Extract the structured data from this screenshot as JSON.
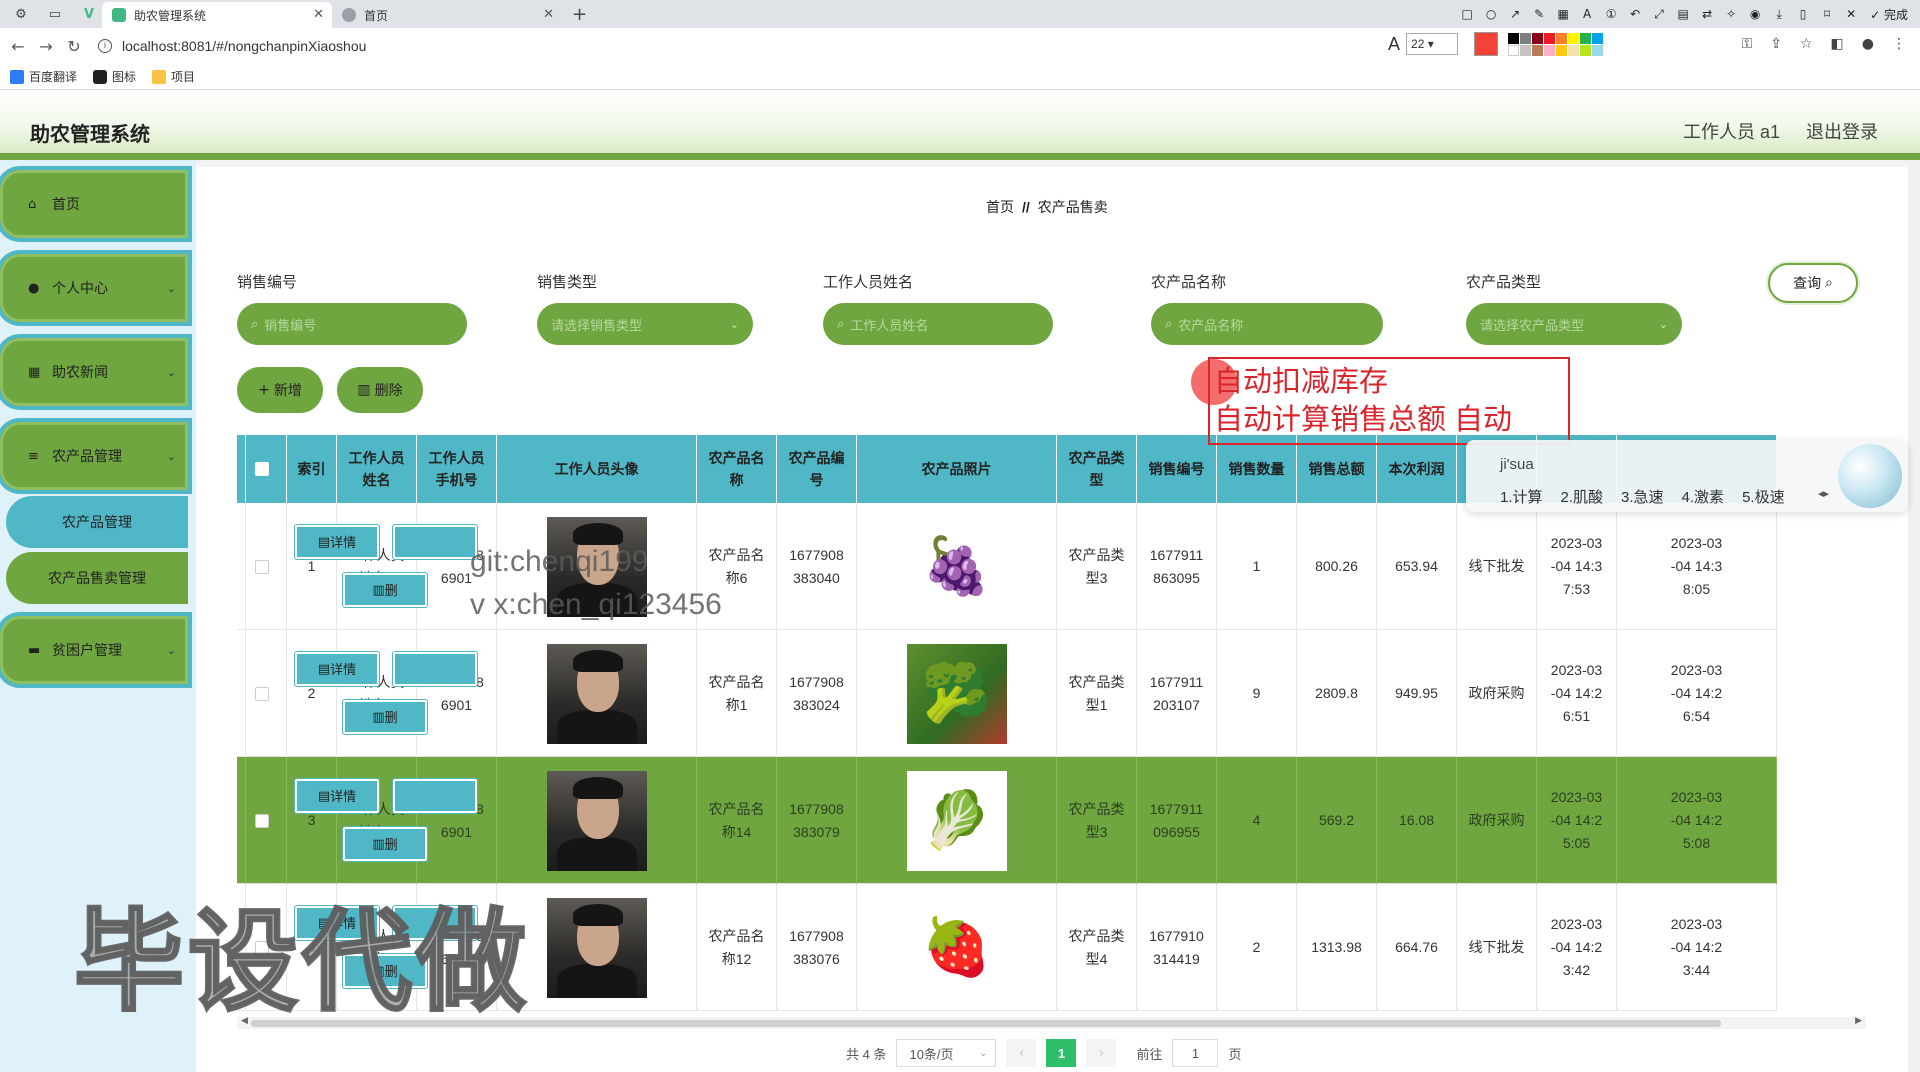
{
  "browser": {
    "tabs": [
      {
        "title": "助农管理系统",
        "active": true
      },
      {
        "title": "首页",
        "active": false
      }
    ],
    "url": "localhost:8081/#/nongchanpinXiaoshou",
    "font_size_value": "22",
    "screenshot_done_label": "完成",
    "bookmarks": [
      "百度翻译",
      "图标",
      "项目"
    ]
  },
  "header": {
    "title": "助农管理系统",
    "user": "工作人员 a1",
    "logout": "退出登录"
  },
  "sidebar": {
    "items": [
      {
        "label": "首页",
        "icon": "home-icon"
      },
      {
        "label": "个人中心",
        "icon": "user-icon"
      },
      {
        "label": "助农新闻",
        "icon": "grid-icon"
      },
      {
        "label": "农产品管理",
        "icon": "list-icon"
      },
      {
        "label": "贫困户管理",
        "icon": "monitor-icon"
      }
    ],
    "sub_items": [
      {
        "label": "农产品管理",
        "active": true
      },
      {
        "label": "农产品售卖管理",
        "active": false
      }
    ]
  },
  "breadcrumb": {
    "home": "首页",
    "sep": "//",
    "current": "农产品售卖"
  },
  "filters": [
    {
      "label": "销售编号",
      "placeholder": "销售编号",
      "type": "input"
    },
    {
      "label": "销售类型",
      "placeholder": "请选择销售类型",
      "type": "select"
    },
    {
      "label": "工作人员姓名",
      "placeholder": "工作人员姓名",
      "type": "input"
    },
    {
      "label": "农产品名称",
      "placeholder": "农产品名称",
      "type": "input"
    },
    {
      "label": "农产品类型",
      "placeholder": "请选择农产品类型",
      "type": "select"
    }
  ],
  "query_label": "查询",
  "actions": {
    "add": "新增",
    "delete": "删除"
  },
  "table": {
    "columns": [
      "索引",
      "工作人员姓名",
      "工作人员手机号",
      "工作人员头像",
      "农产品名称",
      "农产品编号",
      "农产品照片",
      "农产品类型",
      "销售编号",
      "销售数量",
      "销售总额",
      "本次利润",
      "",
      "",
      "",
      ""
    ],
    "column_lines": [
      [
        "索引"
      ],
      [
        "工作人员",
        "姓名"
      ],
      [
        "工作人员",
        "手机号"
      ],
      [
        "工作人员头像"
      ],
      [
        "农产品名",
        "称"
      ],
      [
        "农产品编",
        "号"
      ],
      [
        "农产品照片"
      ],
      [
        "农产品类",
        "型"
      ],
      [
        "销售编号"
      ],
      [
        "销售数量"
      ],
      [
        "销售总额"
      ],
      [
        "本次利润"
      ],
      [
        ""
      ],
      [
        ""
      ],
      [
        ""
      ],
      [
        ""
      ]
    ],
    "rows": [
      {
        "index": "1",
        "name": [
          "工作人员",
          "姓名1"
        ],
        "phone": [
          "1770378",
          "6901"
        ],
        "product": [
          "农产品名",
          "称6"
        ],
        "product_no": [
          "1677908",
          "383040"
        ],
        "photo": "grapes",
        "category": [
          "农产品类",
          "型3"
        ],
        "sale_no": [
          "1677911",
          "863095"
        ],
        "qty": "1",
        "total": "800.26",
        "profit": "653.94",
        "sale_type": "线下批发",
        "time1": [
          "2023-03",
          "-04 14:3",
          "7:53"
        ],
        "time2": [
          "2023-03",
          "-04 14:3",
          "8:05"
        ],
        "highlight": false
      },
      {
        "index": "2",
        "name": [
          "工作人员",
          "姓名1"
        ],
        "phone": [
          "1770378",
          "6901"
        ],
        "product": [
          "农产品名",
          "称1"
        ],
        "product_no": [
          "1677908",
          "383024"
        ],
        "photo": "vegetables",
        "category": [
          "农产品类",
          "型1"
        ],
        "sale_no": [
          "1677911",
          "203107"
        ],
        "qty": "9",
        "total": "2809.8",
        "profit": "949.95",
        "sale_type": "政府采购",
        "time1": [
          "2023-03",
          "-04 14:2",
          "6:51"
        ],
        "time2": [
          "2023-03",
          "-04 14:2",
          "6:54"
        ],
        "highlight": false
      },
      {
        "index": "3",
        "name": [
          "工作人员",
          "姓名1"
        ],
        "phone": [
          "1770378",
          "6901"
        ],
        "product": [
          "农产品名",
          "称14"
        ],
        "product_no": [
          "1677908",
          "383079"
        ],
        "photo": "vegetable-basket",
        "category": [
          "农产品类",
          "型3"
        ],
        "sale_no": [
          "1677911",
          "096955"
        ],
        "qty": "4",
        "total": "569.2",
        "profit": "16.08",
        "sale_type": "政府采购",
        "time1": [
          "2023-03",
          "-04 14:2",
          "5:05"
        ],
        "time2": [
          "2023-03",
          "-04 14:2",
          "5:08"
        ],
        "highlight": true
      },
      {
        "index": "4",
        "name": [
          "工作人员",
          "姓名1"
        ],
        "phone": [
          "1770378",
          "6901"
        ],
        "product": [
          "农产品名",
          "称12"
        ],
        "product_no": [
          "1677908",
          "383076"
        ],
        "photo": "strawberries",
        "category": [
          "农产品类",
          "型4"
        ],
        "sale_no": [
          "1677910",
          "314419"
        ],
        "qty": "2",
        "total": "1313.98",
        "profit": "664.76",
        "sale_type": "线下批发",
        "time1": [
          "2023-03",
          "-04 14:2",
          "3:42"
        ],
        "time2": [
          "2023-03",
          "-04 14:2",
          "3:44"
        ],
        "highlight": false
      }
    ],
    "detail_label": "详情",
    "delete_label": "删"
  },
  "pagination": {
    "total": "共 4 条",
    "page_size": "10条/页",
    "current": "1",
    "goto_prefix": "前往",
    "goto_value": "1",
    "goto_suffix": "页"
  },
  "annotation": {
    "line1": "自动扣减库存",
    "line2": "自动计算销售总额 自动"
  },
  "ime": {
    "pinyin": "ji'sua",
    "candidates": [
      "1.计算",
      "2.肌酸",
      "3.急速",
      "4.激素",
      "5.极速"
    ]
  },
  "watermarks": {
    "git": "git:chenqi199",
    "wx": "v x:chen_qi123456",
    "big": "毕设代做"
  },
  "colors": {
    "green": "#6fa640",
    "teal": "#4fb7c6",
    "annotation_red": "#d9262c",
    "page_active": "#2fbf6a"
  }
}
